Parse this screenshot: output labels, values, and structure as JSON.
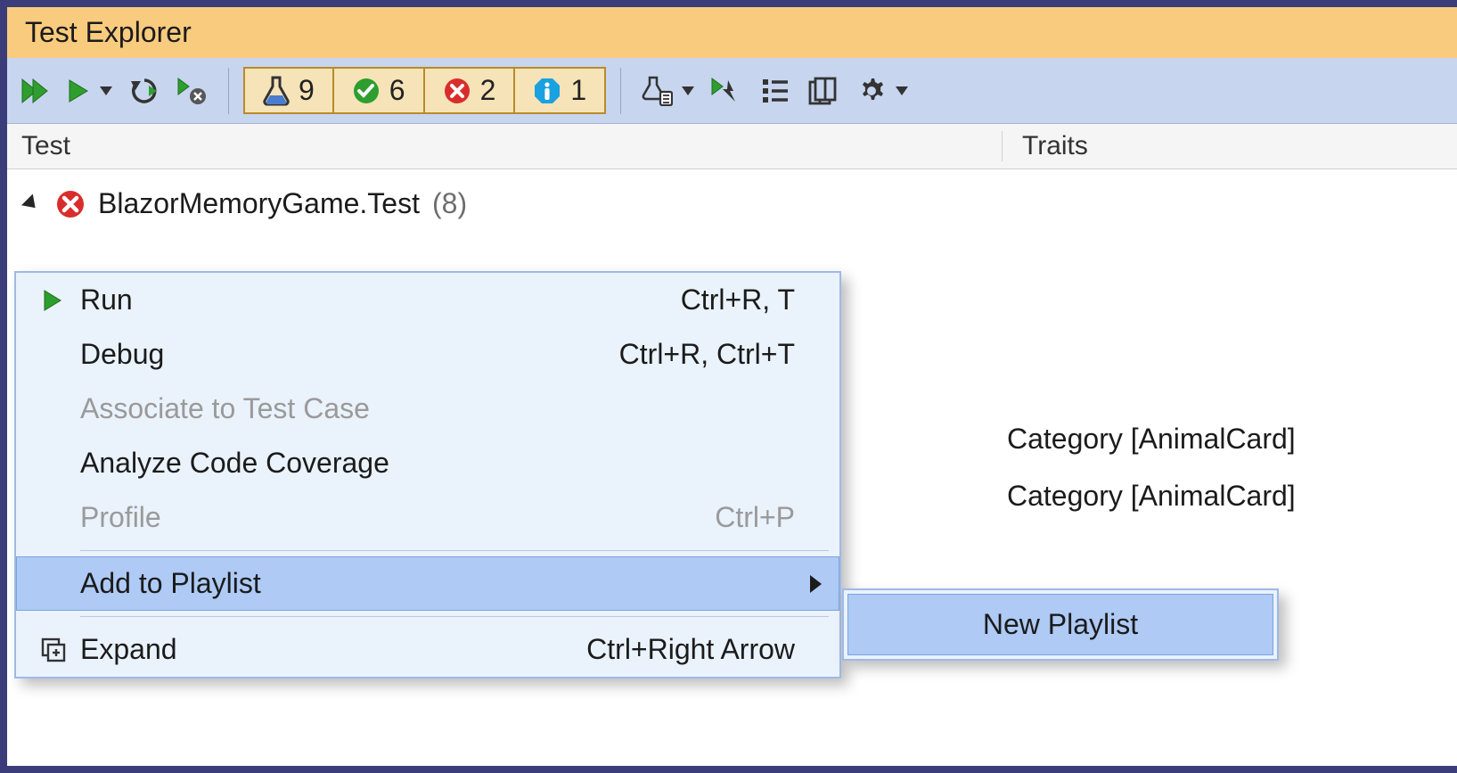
{
  "window": {
    "title": "Test Explorer"
  },
  "columns": {
    "test": "Test",
    "traits": "Traits"
  },
  "summary": {
    "total": "9",
    "passed": "6",
    "failed": "2",
    "info": "1"
  },
  "tree": {
    "root": {
      "name": "BlazorMemoryGame.Test",
      "count": "(8)"
    }
  },
  "traits": {
    "row1": "Category [AnimalCard]",
    "row2": "Category [AnimalCard]"
  },
  "menu": {
    "run": {
      "label": "Run",
      "shortcut": "Ctrl+R, T"
    },
    "debug": {
      "label": "Debug",
      "shortcut": "Ctrl+R, Ctrl+T"
    },
    "associate": {
      "label": "Associate to Test Case"
    },
    "coverage": {
      "label": "Analyze Code Coverage"
    },
    "profile": {
      "label": "Profile",
      "shortcut": "Ctrl+P"
    },
    "playlist": {
      "label": "Add to Playlist"
    },
    "expand": {
      "label": "Expand",
      "shortcut": "Ctrl+Right Arrow"
    }
  },
  "submenu": {
    "new_playlist": "New Playlist"
  }
}
